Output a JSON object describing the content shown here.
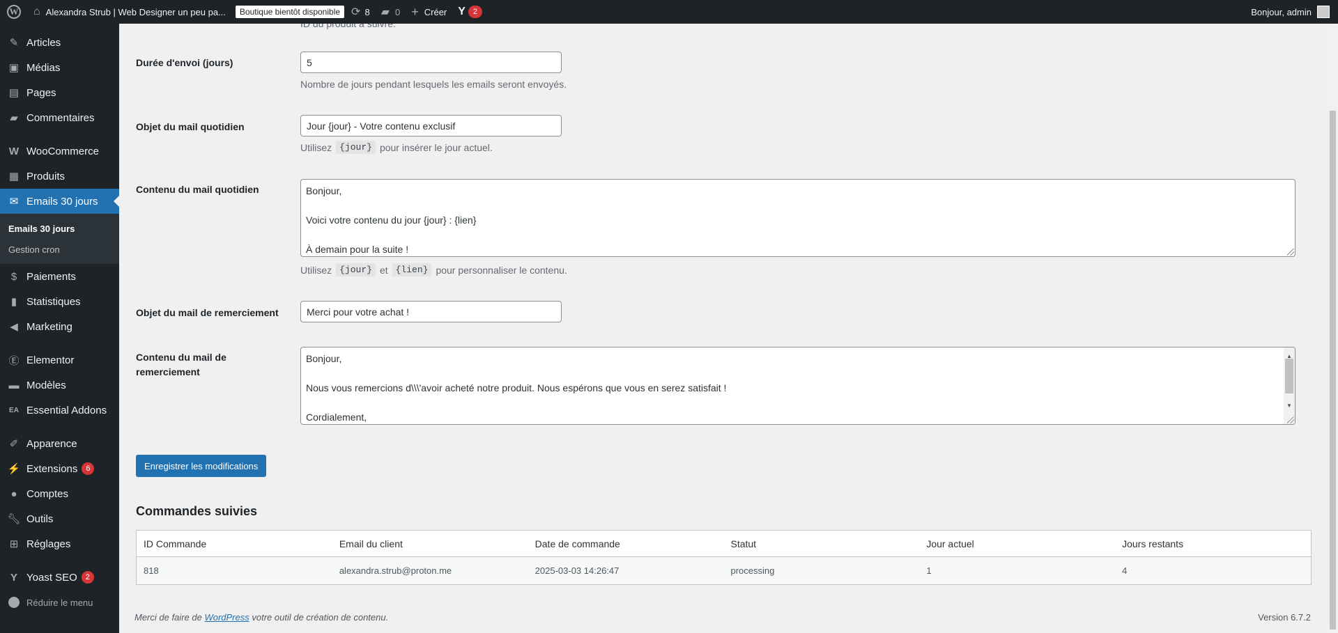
{
  "adminbar": {
    "site_title": "Alexandra Strub | Web Designer un peu pa...",
    "shop_badge": "Boutique bientôt disponible",
    "updates_count": "8",
    "comments_count": "0",
    "new_label": "Créer",
    "yoast_count": "2",
    "greeting": "Bonjour, admin"
  },
  "sidebar": {
    "items": [
      {
        "label": "Articles",
        "icon": "pin-icon"
      },
      {
        "label": "Médias",
        "icon": "media-icon"
      },
      {
        "label": "Pages",
        "icon": "pages-icon"
      },
      {
        "label": "Commentaires",
        "icon": "comments-icon"
      },
      {
        "label": "WooCommerce",
        "icon": "woocommerce-icon"
      },
      {
        "label": "Produits",
        "icon": "products-icon"
      },
      {
        "label": "Emails 30 jours",
        "icon": "email-icon"
      },
      {
        "label": "Paiements",
        "icon": "payments-icon"
      },
      {
        "label": "Statistiques",
        "icon": "stats-icon"
      },
      {
        "label": "Marketing",
        "icon": "megaphone-icon"
      },
      {
        "label": "Elementor",
        "icon": "elementor-icon"
      },
      {
        "label": "Modèles",
        "icon": "folder-icon"
      },
      {
        "label": "Essential Addons",
        "icon": "ea-icon"
      },
      {
        "label": "Apparence",
        "icon": "brush-icon"
      },
      {
        "label": "Extensions",
        "icon": "plugin-icon",
        "badge": "6"
      },
      {
        "label": "Comptes",
        "icon": "user-icon"
      },
      {
        "label": "Outils",
        "icon": "wrench-icon"
      },
      {
        "label": "Réglages",
        "icon": "settings-icon"
      },
      {
        "label": "Yoast SEO",
        "icon": "yoast-icon",
        "badge": "2"
      }
    ],
    "submenu": [
      "Emails 30 jours",
      "Gestion cron"
    ],
    "collapse_label": "Réduire le menu"
  },
  "form": {
    "cut_text": "ID du produit à suivre.",
    "duration_label": "Durée d'envoi (jours)",
    "duration_value": "5",
    "duration_desc": "Nombre de jours pendant lesquels les emails seront envoyés.",
    "daily_subject_label": "Objet du mail quotidien",
    "daily_subject_value": "Jour {jour} - Votre contenu exclusif",
    "daily_subject_desc_pre": "Utilisez",
    "daily_subject_desc_code": "{jour}",
    "daily_subject_desc_post": "pour insérer le jour actuel.",
    "daily_content_label": "Contenu du mail quotidien",
    "daily_content_lines": [
      "Bonjour,",
      "",
      "Voici votre contenu du jour {jour} : {lien}",
      "",
      "À demain pour la suite !"
    ],
    "daily_content_desc_pre": "Utilisez",
    "daily_content_desc_code1": "{jour}",
    "daily_content_desc_mid": "et",
    "daily_content_desc_code2": "{lien}",
    "daily_content_desc_post": "pour personnaliser le contenu.",
    "thanks_subject_label": "Objet du mail de remerciement",
    "thanks_subject_value": "Merci pour votre achat !",
    "thanks_content_label": "Contenu du mail de remerciement",
    "thanks_content_lines": [
      "Bonjour,",
      "",
      "Nous vous remercions d\\\\\\'avoir acheté notre produit. Nous espérons que vous en serez satisfait !",
      "",
      "Cordialement,"
    ],
    "save_button": "Enregistrer les modifications"
  },
  "orders": {
    "title": "Commandes suivies",
    "columns": [
      "ID Commande",
      "Email du client",
      "Date de commande",
      "Statut",
      "Jour actuel",
      "Jours restants"
    ],
    "rows": [
      [
        "818",
        "alexandra.strub@proton.me",
        "2025-03-03 14:26:47",
        "processing",
        "1",
        "4"
      ]
    ]
  },
  "footer": {
    "text_pre": "Merci de faire de",
    "link": "WordPress",
    "text_post": "votre outil de création de contenu.",
    "version": "Version 6.7.2"
  }
}
